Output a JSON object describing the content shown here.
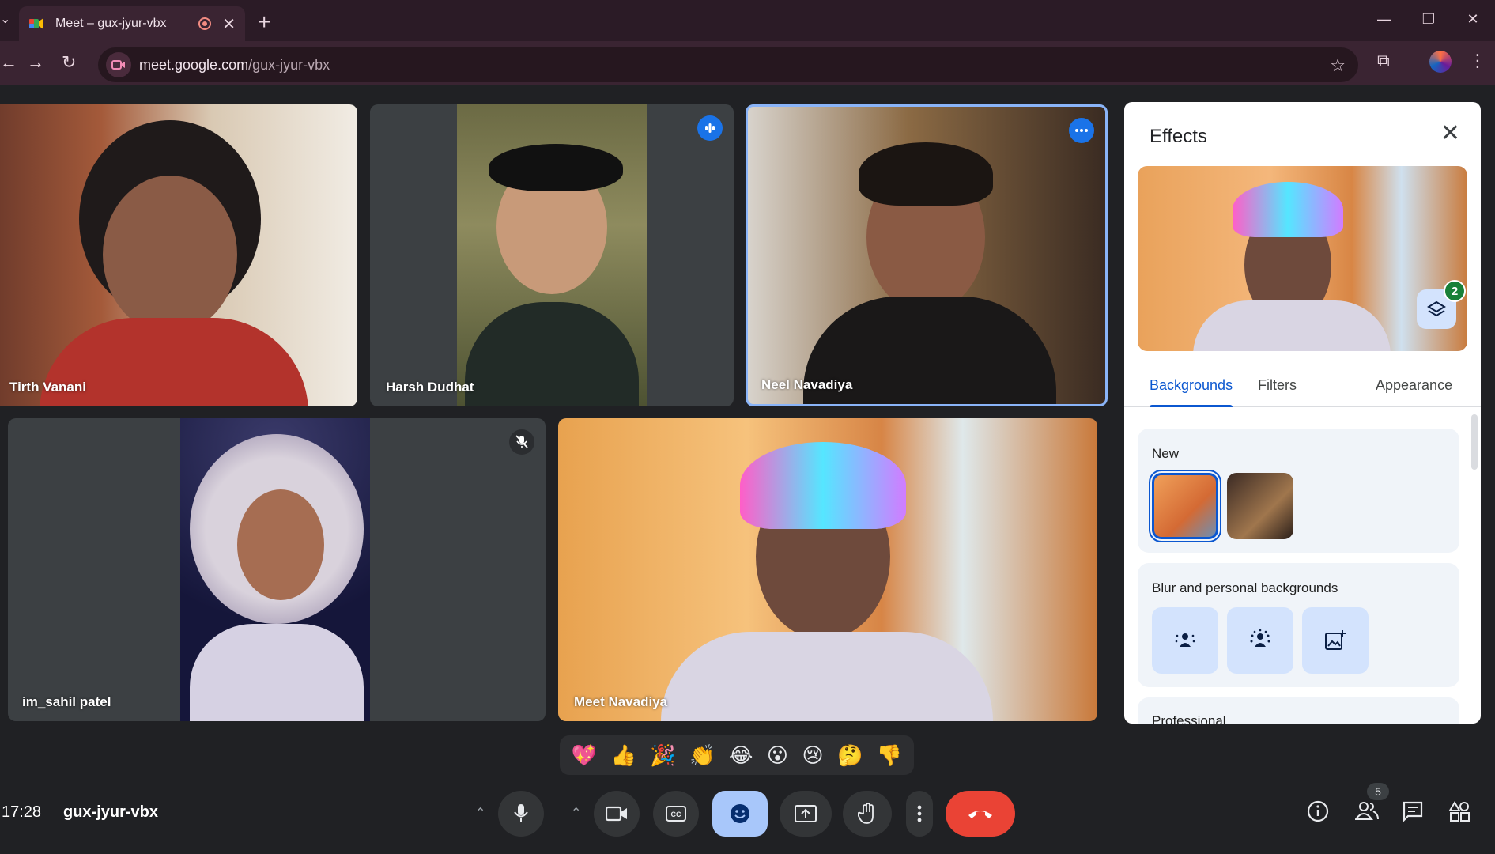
{
  "browser": {
    "tab_title": "Meet – gux-jyur-vbx",
    "tab_close": "✕",
    "new_tab": "+",
    "url_host": "meet.google.com",
    "url_path": "/gux-jyur-vbx"
  },
  "participants": [
    {
      "name": "Tirth Vanani"
    },
    {
      "name": "Harsh Dudhat"
    },
    {
      "name": "Neel Navadiya"
    },
    {
      "name": "im_sahil patel"
    },
    {
      "name": "Meet Navadiya"
    }
  ],
  "effects": {
    "title": "Effects",
    "layers_count": "2",
    "tabs": [
      "Backgrounds",
      "Filters",
      "Appearance"
    ],
    "active_tab": "Backgrounds",
    "sections": {
      "new": "New",
      "blur": "Blur and personal backgrounds",
      "professional": "Professional"
    }
  },
  "reactions": [
    "💖",
    "👍",
    "🎉",
    "👏",
    "😂",
    "😮",
    "😢",
    "🤔",
    "👎"
  ],
  "bottom": {
    "time": "17:28",
    "meeting_code": "gux-jyur-vbx",
    "people_count": "5"
  },
  "colors": {
    "accent": "#1a73e8",
    "active_control": "#a8c7fa",
    "end_call": "#ea4335",
    "tab_active": "#0b57d0"
  }
}
